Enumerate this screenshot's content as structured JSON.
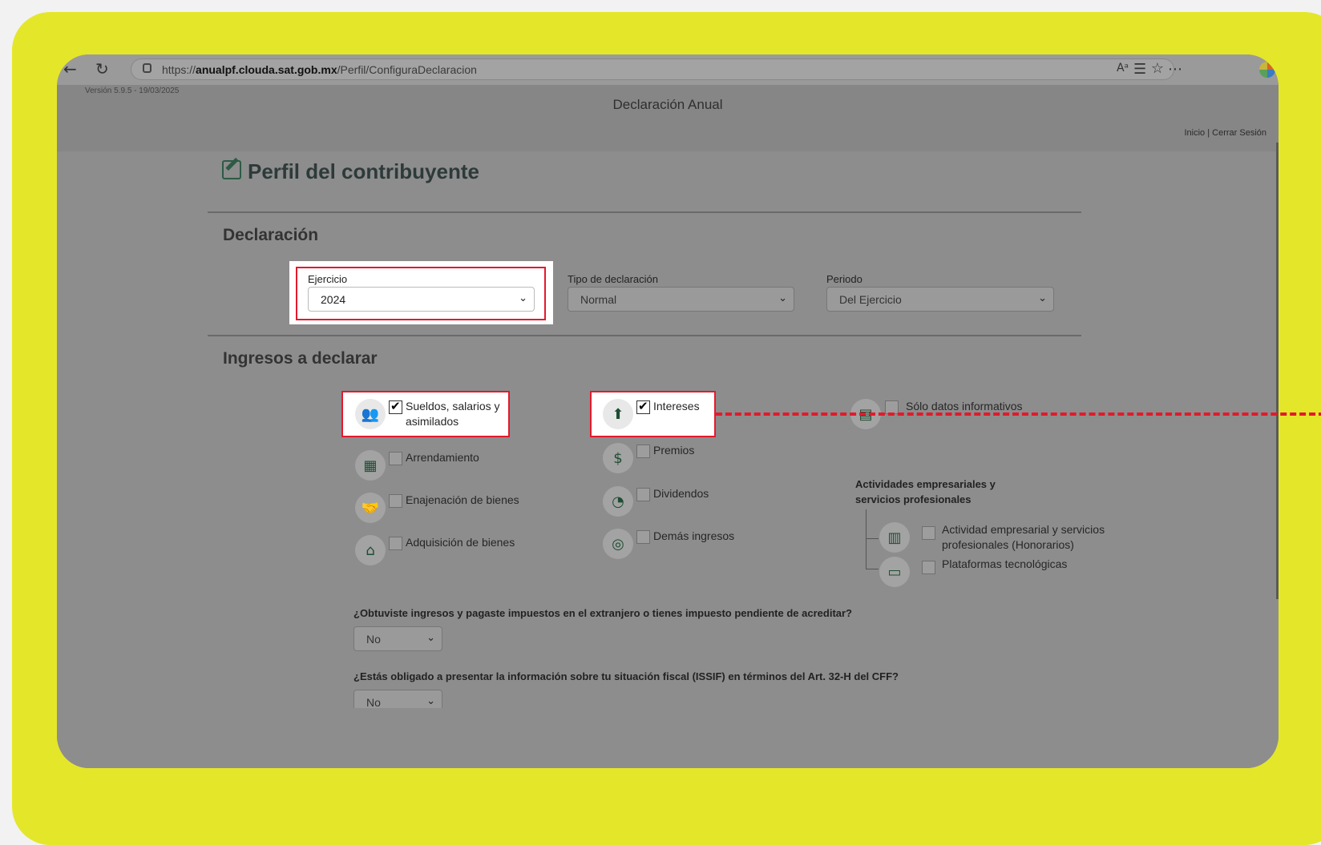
{
  "browser": {
    "url_prefix": "https://",
    "url_domain": "anualpf.clouda.sat.gob.mx",
    "url_path": "/Perfil/ConfiguraDeclaracion",
    "back_icon": "back-arrow-icon",
    "refresh_icon": "refresh-icon"
  },
  "header": {
    "version": "Versión 5.9.5 - 19/03/2025",
    "title": "Declaración Anual",
    "links": "Inicio | Cerrar Sesión"
  },
  "page": {
    "title": "Perfil del contribuyente"
  },
  "declaracion": {
    "section_title": "Declaración",
    "ejercicio_label": "Ejercicio",
    "ejercicio_value": "2024",
    "tipo_label": "Tipo de declaración",
    "tipo_value": "Normal",
    "periodo_label": "Periodo",
    "periodo_value": "Del Ejercicio"
  },
  "ingresos": {
    "section_title": "Ingresos a declarar",
    "col1": [
      {
        "label": "Sueldos, salarios y asimilados",
        "checked": true
      },
      {
        "label": "Arrendamiento",
        "checked": false
      },
      {
        "label": "Enajenación de bienes",
        "checked": false
      },
      {
        "label": "Adquisición de bienes",
        "checked": false
      }
    ],
    "col2": [
      {
        "label": "Intereses",
        "checked": true
      },
      {
        "label": "Premios",
        "checked": false
      },
      {
        "label": "Dividendos",
        "checked": false
      },
      {
        "label": "Demás ingresos",
        "checked": false
      }
    ],
    "solo_datos": "Sólo datos informativos",
    "actividades_heading": "Actividades empresariales y servicios profesionales",
    "actividad_empresarial": "Actividad empresarial y servicios profesionales (Honorarios)",
    "plataformas": "Plataformas tecnológicas"
  },
  "questions": {
    "q1": "¿Obtuviste ingresos y pagaste impuestos en el extranjero o tienes impuesto pendiente de acreditar?",
    "q1_value": "No",
    "q2": "¿Estás obligado a presentar la información sobre tu situación fiscal (ISSIF) en términos del Art. 32-H del CFF?",
    "q2_value": "No"
  },
  "colors": {
    "frame": "#e4e62a",
    "highlight": "#e21a2c",
    "icon_green": "#1f4d33"
  }
}
